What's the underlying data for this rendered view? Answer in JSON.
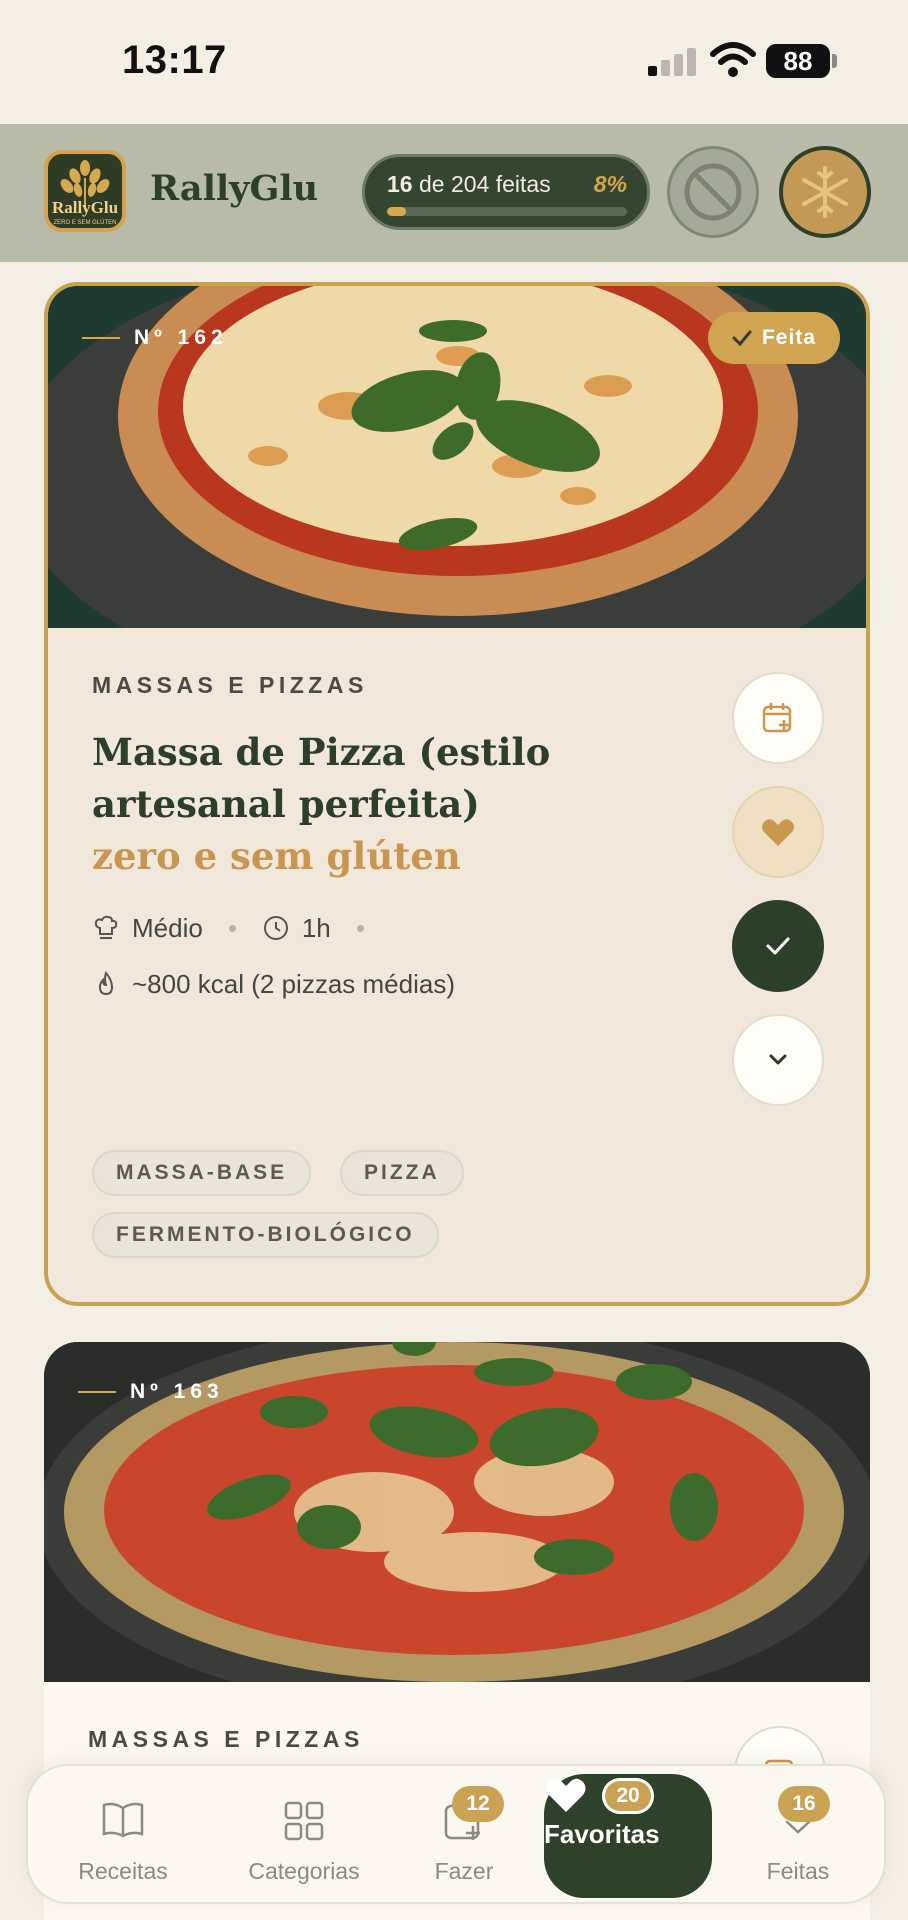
{
  "status_bar": {
    "time": "13:17",
    "battery": "88"
  },
  "header": {
    "logo_text": "RallyGlu",
    "logo_subtext": "ZERO E SEM GLÚTEN",
    "brand": "RallyGlu",
    "progress": {
      "done": "16",
      "rest": "de 204 feitas",
      "percent": "8%",
      "fraction": 0.08
    }
  },
  "cards": [
    {
      "number": "Nº 162",
      "done_badge": "Feita",
      "category": "MASSAS E PIZZAS",
      "title": "Massa de Pizza (estilo artesanal perfeita)",
      "title_accent": "zero e sem glúten",
      "difficulty": "Médio",
      "time": "1h",
      "calories": "~800 kcal (2 pizzas médias)",
      "tags": [
        "MASSA-BASE",
        "PIZZA",
        "FERMENTO-BIOLÓGICO"
      ]
    },
    {
      "number": "Nº 163",
      "category": "MASSAS E PIZZAS"
    }
  ],
  "nav": {
    "items": [
      {
        "label": "Receitas",
        "icon": "book-icon"
      },
      {
        "label": "Categorias",
        "icon": "grid-icon"
      },
      {
        "label": "Fazer",
        "icon": "calendar-plus-icon",
        "badge": "12"
      },
      {
        "label": "Favoritas",
        "icon": "heart-icon",
        "badge": "20",
        "active": true
      },
      {
        "label": "Feitas",
        "icon": "check-icon",
        "badge": "16"
      }
    ]
  },
  "colors": {
    "accent": "#c9a254",
    "primary": "#2e4129",
    "background": "#f4efe4"
  }
}
